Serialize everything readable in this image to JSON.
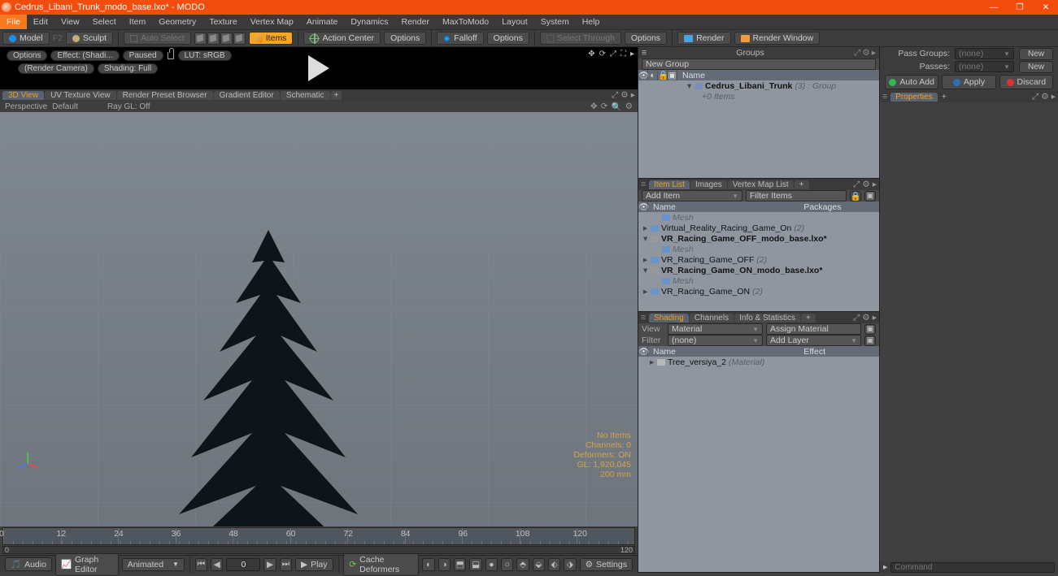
{
  "window": {
    "title": "Cedrus_Libani_Trunk_modo_base.lxo* - MODO"
  },
  "menus": [
    "File",
    "Edit",
    "View",
    "Select",
    "Item",
    "Geometry",
    "Texture",
    "Vertex Map",
    "Animate",
    "Dynamics",
    "Render",
    "MaxToModo",
    "Layout",
    "System",
    "Help"
  ],
  "toolrow": {
    "model": "Model",
    "f2": "F2",
    "sculpt": "Sculpt",
    "autoselect": "Auto Select",
    "items": "Items",
    "actioncenter": "Action Center",
    "options": "Options",
    "falloff": "Falloff",
    "options2": "Options",
    "selthrough": "Select Through",
    "options3": "Options",
    "render": "Render",
    "renderwindow": "Render Window"
  },
  "blackbar": {
    "options": "Options",
    "effect": "Effect: (Shadi...",
    "paused": "Paused",
    "lut": "LUT: sRGB",
    "rendercam": "(Render Camera)",
    "shading": "Shading: Full"
  },
  "viewtabs": [
    "3D View",
    "UV Texture View",
    "Render Preset Browser",
    "Gradient Editor",
    "Schematic"
  ],
  "viewopt": {
    "persp": "Perspective",
    "default": "Default",
    "raygl": "Ray GL: Off"
  },
  "vpstats": {
    "noitems": "No Items",
    "channels": "Channels: 0",
    "deformers": "Deformers: ON",
    "gl": "GL: 1,920,045",
    "mm": "200 mm"
  },
  "timeline": {
    "labels": [
      "0",
      "12",
      "24",
      "36",
      "48",
      "60",
      "72",
      "84",
      "96",
      "108",
      "120"
    ],
    "rangeL": "0",
    "rangeR": "120"
  },
  "playbar": {
    "audio": "Audio",
    "grapheditor": "Graph Editor",
    "animated": "Animated",
    "frame": "0",
    "play": "Play",
    "cachedef": "Cache Deformers",
    "settings": "Settings"
  },
  "groupspanel": {
    "title": "Groups",
    "newgroup": "New Group",
    "namecol": "Name",
    "item": "Cedrus_Libani_Trunk",
    "item_suffix": "(3) : Group",
    "sub": "+0 Items"
  },
  "itemlist": {
    "tabs": [
      "Item List",
      "Images",
      "Vertex Map List"
    ],
    "add": "Add Item",
    "filter": "Filter Items",
    "cols": {
      "name": "Name",
      "packages": "Packages"
    },
    "rows": [
      {
        "indent": 1,
        "icon": "mesh",
        "label": "Mesh",
        "muted": true
      },
      {
        "indent": 0,
        "exp": "▸",
        "icon": "mesh",
        "label": "Virtual_Reality_Racing_Game_On",
        "suffix": "(2)"
      },
      {
        "indent": 0,
        "exp": "▾",
        "icon": "scene",
        "label": "VR_Racing_Game_OFF_modo_base.lxo*",
        "bold": true
      },
      {
        "indent": 1,
        "exp": "",
        "icon": "mesh",
        "label": "Mesh",
        "muted": true
      },
      {
        "indent": 0,
        "exp": "▸",
        "icon": "mesh",
        "label": "VR_Racing_Game_OFF",
        "suffix": "(2)"
      },
      {
        "indent": 0,
        "exp": "▾",
        "icon": "scene",
        "label": "VR_Racing_Game_ON_modo_base.lxo*",
        "bold": true
      },
      {
        "indent": 1,
        "exp": "",
        "icon": "mesh",
        "label": "Mesh",
        "muted": true
      },
      {
        "indent": 0,
        "exp": "▸",
        "icon": "mesh",
        "label": "VR_Racing_Game_ON",
        "suffix": "(2)"
      }
    ]
  },
  "shadingpanel": {
    "tabs": [
      "Shading",
      "Channels",
      "Info & Statistics"
    ],
    "viewlabel": "View",
    "viewval": "Material",
    "assign": "Assign Material",
    "filterlabel": "Filter",
    "filterval": "(none)",
    "addlayer": "Add Layer",
    "cols": {
      "name": "Name",
      "effect": "Effect"
    },
    "row": {
      "label": "Tree_versiya_2",
      "suffix": "(Material)"
    }
  },
  "right": {
    "passgroups_label": "Pass Groups:",
    "passgroups_val": "(none)",
    "new": "New",
    "passes_label": "Passes:",
    "passes_val": "(none)",
    "new2": "New",
    "autoadd": "Auto Add",
    "apply": "Apply",
    "discard": "Discard",
    "proptab": "Properties"
  },
  "cmd": {
    "label": "Command"
  }
}
